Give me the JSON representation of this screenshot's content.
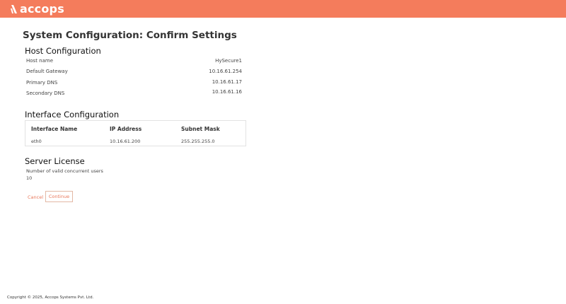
{
  "brand": {
    "logo_text": "accops",
    "bar_color": "#f47c5c",
    "accent_color": "#e8775a"
  },
  "page": {
    "title": "System Configuration: Confirm Settings"
  },
  "host_configuration": {
    "title": "Host Configuration",
    "rows": [
      {
        "label": "Host name",
        "value": "HySecure1"
      },
      {
        "label": "Default Gateway",
        "value": "10.16.61.254"
      },
      {
        "label": "Primary DNS",
        "value": "10.16.61.17"
      },
      {
        "label": "Secondary DNS",
        "value": "10.16.61.16"
      }
    ]
  },
  "interface_configuration": {
    "title": "Interface Configuration",
    "columns": [
      "Interface Name",
      "IP Address",
      "Subnet Mask"
    ],
    "rows": [
      [
        "eth0",
        "10.16.61.200",
        "255.255.255.0"
      ]
    ]
  },
  "server_license": {
    "title": "Server License",
    "label": "Number of valid concurrent users",
    "value": "10"
  },
  "actions": {
    "cancel_label": "Cancel",
    "continue_label": "Continue"
  },
  "footer": {
    "copyright": "Copyright © 2025, Accops Systems Pvt. Ltd."
  }
}
